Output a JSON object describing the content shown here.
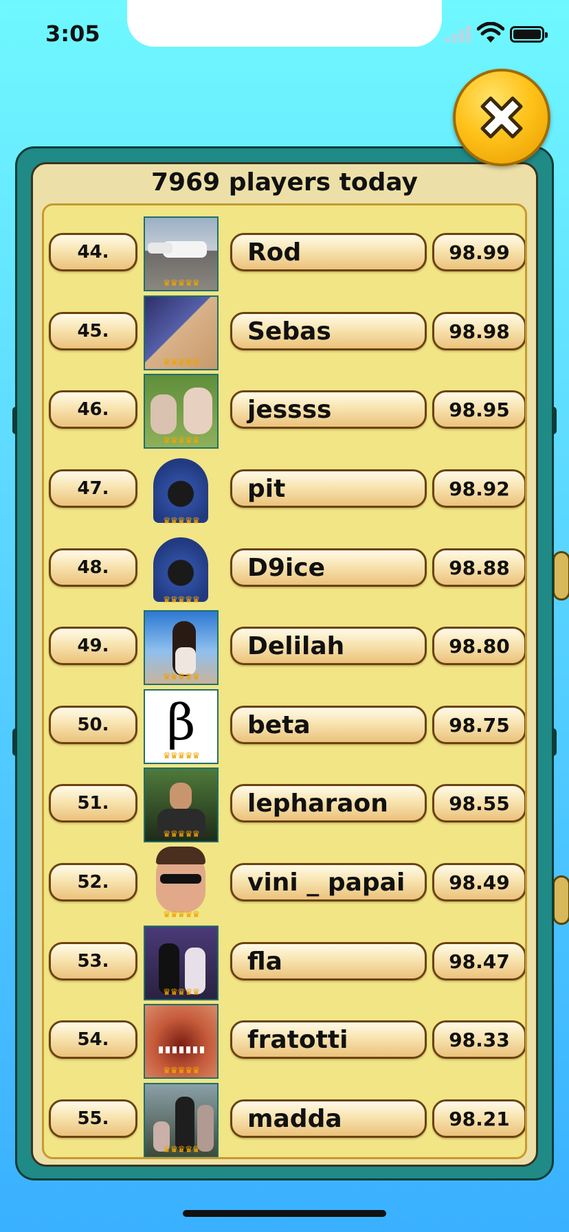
{
  "status_bar": {
    "time": "3:05"
  },
  "header": {
    "title": "7969 players today"
  },
  "leaderboard": [
    {
      "rank": "44.",
      "name": "Rod",
      "score": "98.99",
      "avatar": "photo-cars",
      "framed": true
    },
    {
      "rank": "45.",
      "name": "Sebas",
      "score": "98.98",
      "avatar": "photo-dog",
      "framed": true
    },
    {
      "rank": "46.",
      "name": "jessss",
      "score": "98.95",
      "avatar": "photo-kids",
      "framed": true
    },
    {
      "rank": "47.",
      "name": "pit",
      "score": "98.92",
      "avatar": "hooded-figure",
      "framed": false
    },
    {
      "rank": "48.",
      "name": "D9ice",
      "score": "98.88",
      "avatar": "hooded-figure",
      "framed": false
    },
    {
      "rank": "49.",
      "name": "Delilah",
      "score": "98.80",
      "avatar": "photo-woman-beach",
      "framed": true
    },
    {
      "rank": "50.",
      "name": "beta",
      "score": "98.75",
      "avatar": "beta-letter",
      "framed": true
    },
    {
      "rank": "51.",
      "name": "lepharaon",
      "score": "98.55",
      "avatar": "photo-man",
      "framed": true
    },
    {
      "rank": "52.",
      "name": "vini _ papai",
      "score": "98.49",
      "avatar": "sunglasses-face",
      "framed": false
    },
    {
      "rank": "53.",
      "name": "fla",
      "score": "98.47",
      "avatar": "photo-party",
      "framed": true
    },
    {
      "rank": "54.",
      "name": "fratotti",
      "score": "98.33",
      "avatar": "photo-teeth",
      "framed": true
    },
    {
      "rank": "55.",
      "name": "madda",
      "score": "98.21",
      "avatar": "photo-group",
      "framed": true
    }
  ],
  "colors": {
    "panel_teal": "#1f8a86",
    "list_background": "#f1e586",
    "close_button": "#ffc21a",
    "crown": "#f0a400"
  }
}
